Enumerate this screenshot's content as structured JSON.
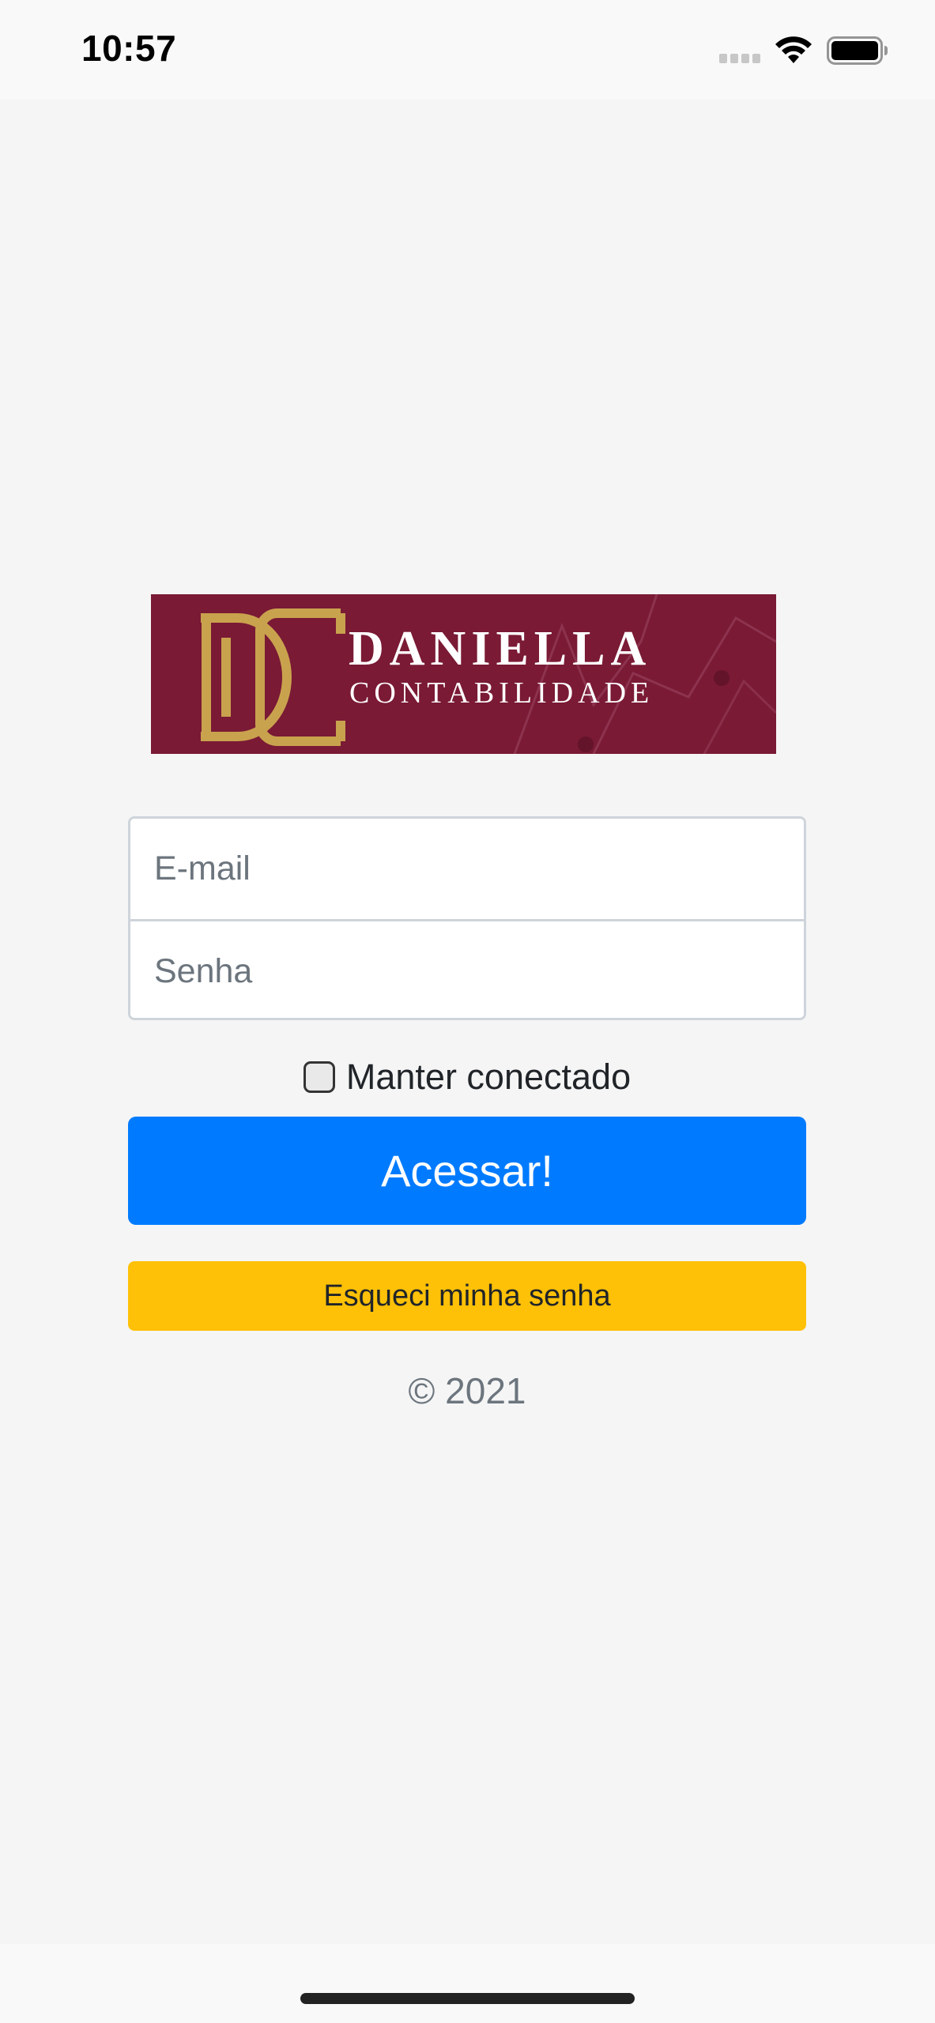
{
  "status_bar": {
    "time": "10:57"
  },
  "logo": {
    "brand_name": "DANIELLA",
    "brand_sub": "CONTABILIDADE",
    "monogram": "DC",
    "colors": {
      "background": "#7a1a35",
      "gold": "#c9a24e",
      "text": "#ffffff"
    }
  },
  "form": {
    "email_placeholder": "E-mail",
    "email_value": "",
    "password_placeholder": "Senha",
    "password_value": "",
    "remember_label": "Manter conectado",
    "remember_checked": false,
    "login_button_label": "Acessar!",
    "forgot_button_label": "Esqueci minha senha"
  },
  "footer": {
    "copyright": "© 2021"
  },
  "colors": {
    "primary": "#007bff",
    "warning": "#ffc107",
    "page_background": "#f5f5f5"
  },
  "icons": {
    "signal": "cellular-signal-icon",
    "wifi": "wifi-icon",
    "battery": "battery-icon"
  }
}
